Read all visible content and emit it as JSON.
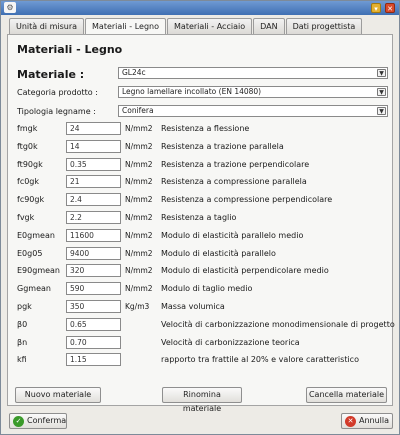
{
  "tabs": [
    "Unità di misura",
    "Materiali - Legno",
    "Materiali - Acciaio",
    "DAN",
    "Dati progettista"
  ],
  "heading": "Materiali - Legno",
  "materiale": {
    "label": "Materiale :",
    "value": "GL24c"
  },
  "categoria": {
    "label": "Categoria prodotto :",
    "value": "Legno lamellare incollato (EN 14080)"
  },
  "tipologia": {
    "label": "Tipologia legname :",
    "value": "Conifera"
  },
  "properties": [
    {
      "sym": "fmgk",
      "value": "24",
      "unit": "N/mm2",
      "desc": "Resistenza a flessione"
    },
    {
      "sym": "ftg0k",
      "value": "14",
      "unit": "N/mm2",
      "desc": "Resistenza a trazione parallela"
    },
    {
      "sym": "ft90gk",
      "value": "0.35",
      "unit": "N/mm2",
      "desc": "Resistenza a trazione perpendicolare"
    },
    {
      "sym": "fc0gk",
      "value": "21",
      "unit": "N/mm2",
      "desc": "Resistenza a compressione parallela"
    },
    {
      "sym": "fc90gk",
      "value": "2.4",
      "unit": "N/mm2",
      "desc": "Resistenza a compressione perpendicolare"
    },
    {
      "sym": "fvgk",
      "value": "2.2",
      "unit": "N/mm2",
      "desc": "Resistenza a taglio"
    },
    {
      "sym": "E0gmean",
      "value": "11600",
      "unit": "N/mm2",
      "desc": "Modulo di elasticità  parallelo medio"
    },
    {
      "sym": "E0g05",
      "value": "9400",
      "unit": "N/mm2",
      "desc": "Modulo di elasticità  parallelo"
    },
    {
      "sym": "E90gmean",
      "value": "320",
      "unit": "N/mm2",
      "desc": "Modulo di elasticità  perpendicolare medio"
    },
    {
      "sym": "Ggmean",
      "value": "590",
      "unit": "N/mm2",
      "desc": "Modulo di taglio medio"
    },
    {
      "sym": "pgk",
      "value": "350",
      "unit": "Kg/m3",
      "desc": "Massa volumica"
    },
    {
      "sym": "β0",
      "value": "0.65",
      "unit": "",
      "desc": "Velocità di carbonizzazione monodimensionale di progetto"
    },
    {
      "sym": "βn",
      "value": "0.70",
      "unit": "",
      "desc": "Velocità di carbonizzazione teorica"
    },
    {
      "sym": "kfi",
      "value": "1.15",
      "unit": "",
      "desc": "rapporto tra frattile al 20% e valore caratteristico"
    }
  ],
  "buttons": {
    "nuovo": "Nuovo materiale",
    "rinomina": "Rinomina materiale",
    "cancella": "Cancella materiale",
    "conferma": "Conferma",
    "annulla": "Annulla"
  },
  "icons": {
    "conferma": "check-icon",
    "annulla": "close-icon"
  }
}
